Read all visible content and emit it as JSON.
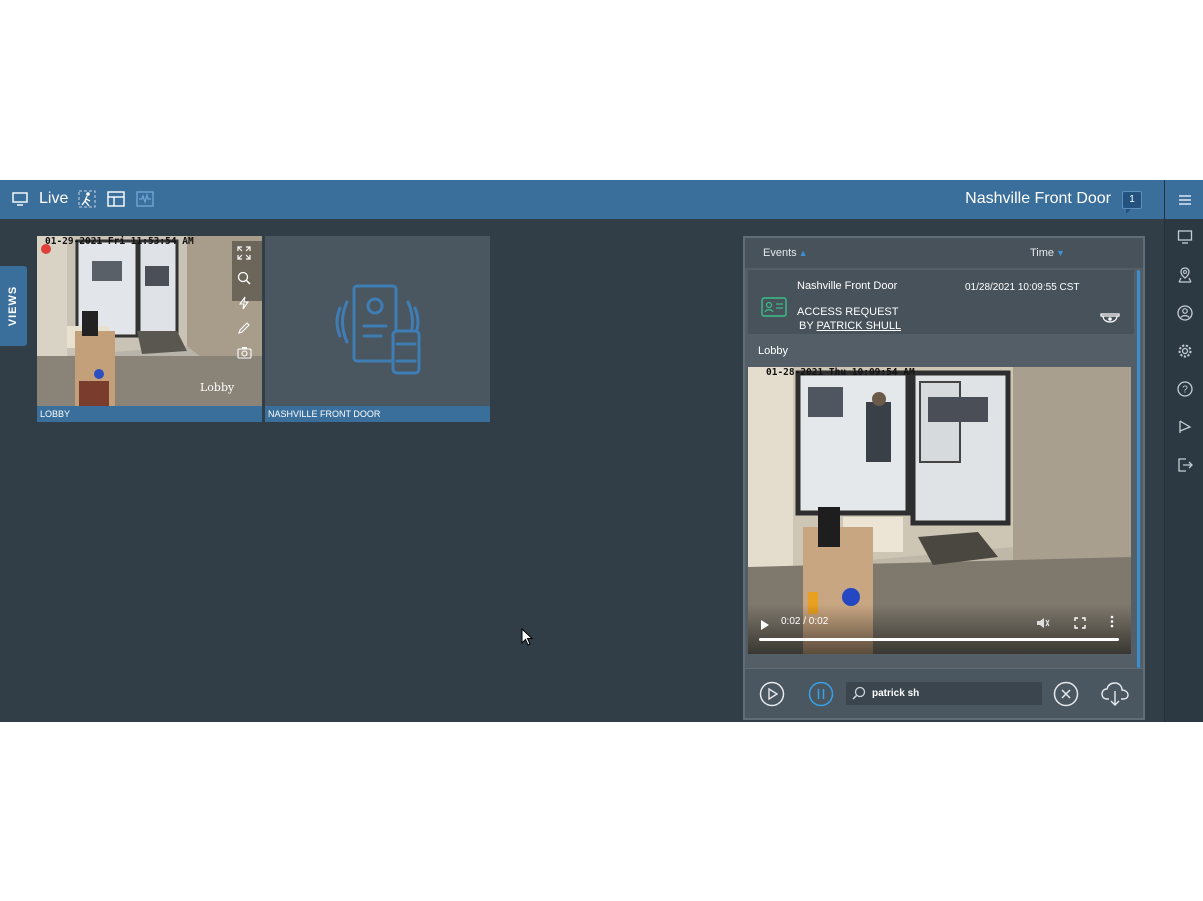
{
  "header": {
    "mode_label": "Live",
    "site_title": "Nashville Front Door",
    "notification_count": "1"
  },
  "sidebar_tab": {
    "label": "VIEWS"
  },
  "tiles": [
    {
      "caption": "LOBBY",
      "timestamp": "01-29-2021 Fri 11:53:54 AM",
      "watermark": "Lobby"
    },
    {
      "caption": "NASHVILLE FRONT DOOR"
    }
  ],
  "events_panel": {
    "col_events": "Events",
    "col_time": "Time",
    "event": {
      "location": "Nashville Front Door",
      "datetime": "01/28/2021 10:09:55 CST",
      "type": "ACCESS REQUEST",
      "by_prefix": "BY ",
      "user": "PATRICK SHULL"
    },
    "clip_label": "Lobby",
    "clip_timestamp": "01-28-2021 Thu 10:09:54 AM",
    "video_time": "0:02 / 0:02",
    "search_value": "patrick sh"
  },
  "colors": {
    "accent": "#3a6e9b",
    "background": "#313e48",
    "highlight": "#3a8fd0"
  }
}
